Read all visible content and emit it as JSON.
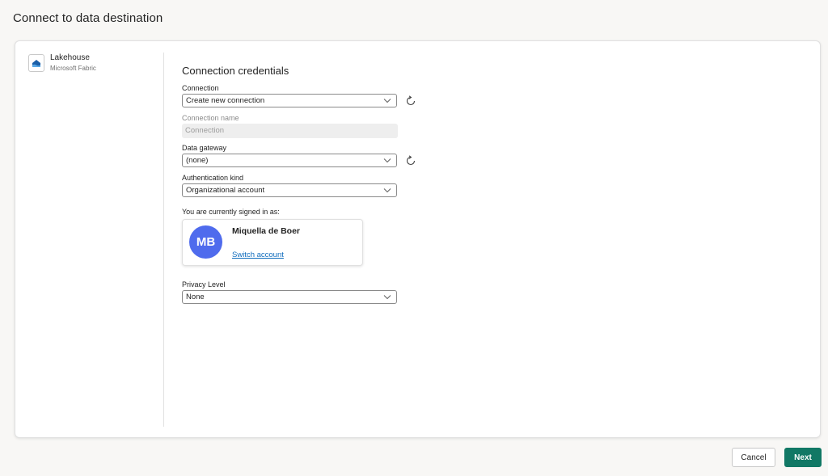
{
  "page": {
    "title": "Connect to data destination"
  },
  "source": {
    "name": "Lakehouse",
    "subtitle": "Microsoft Fabric",
    "icon": "lakehouse-icon"
  },
  "form": {
    "section_title": "Connection credentials",
    "connection": {
      "label": "Connection",
      "value": "Create new connection"
    },
    "connection_name": {
      "label": "Connection name",
      "placeholder": "Connection"
    },
    "data_gateway": {
      "label": "Data gateway",
      "value": "(none)"
    },
    "authentication_kind": {
      "label": "Authentication kind",
      "value": "Organizational account"
    },
    "signed_in": {
      "label": "You are currently signed in as:",
      "initials": "MB",
      "name": "Miquella de Boer",
      "switch_label": "Switch account"
    },
    "privacy_level": {
      "label": "Privacy Level",
      "value": "None"
    }
  },
  "footer": {
    "cancel_label": "Cancel",
    "next_label": "Next"
  },
  "colors": {
    "primary_button": "#117865",
    "avatar": "#4f6bed",
    "link": "#0f6cbd"
  }
}
